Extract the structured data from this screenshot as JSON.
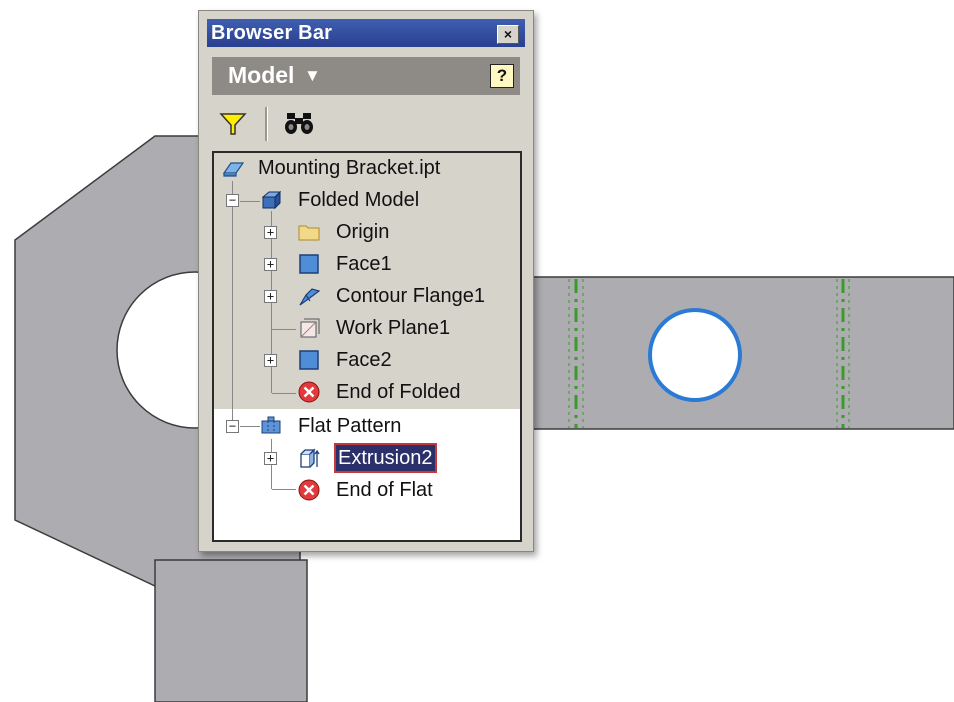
{
  "window": {
    "title": "Browser Bar",
    "close_glyph": "×"
  },
  "model_bar": {
    "label": "Model",
    "dropdown_glyph": "▼",
    "help_glyph": "?"
  },
  "toolbar": {
    "filter_icon": "filter-icon",
    "find_icon": "find-binoculars-icon"
  },
  "tree": {
    "root": {
      "label": "Mounting Bracket.ipt",
      "icon": "part-icon"
    },
    "folded_model": {
      "label": "Folded Model",
      "icon": "folded-model-icon",
      "expanded": true
    },
    "folded_children": [
      {
        "label": "Origin",
        "icon": "folder-icon",
        "expandable": true
      },
      {
        "label": "Face1",
        "icon": "face-icon",
        "expandable": true
      },
      {
        "label": "Contour Flange1",
        "icon": "contour-flange-icon",
        "expandable": true
      },
      {
        "label": "Work Plane1",
        "icon": "work-plane-icon",
        "expandable": false
      },
      {
        "label": "Face2",
        "icon": "face-icon",
        "expandable": true
      },
      {
        "label": "End of Folded",
        "icon": "end-of-part-icon",
        "expandable": false
      }
    ],
    "flat_pattern": {
      "label": "Flat Pattern",
      "icon": "flat-pattern-icon",
      "expanded": true
    },
    "flat_children": [
      {
        "label": "Extrusion2",
        "icon": "extrusion-icon",
        "expandable": true,
        "selected": true
      },
      {
        "label": "End of Flat",
        "icon": "end-of-part-icon",
        "expandable": false
      }
    ]
  },
  "colors": {
    "part_fill": "#adadb1",
    "bend_line": "#3a9a2a",
    "hole_edge": "#2a7ad6",
    "title_bar": "#2a3f8f",
    "selection": "#2b2f6a"
  }
}
